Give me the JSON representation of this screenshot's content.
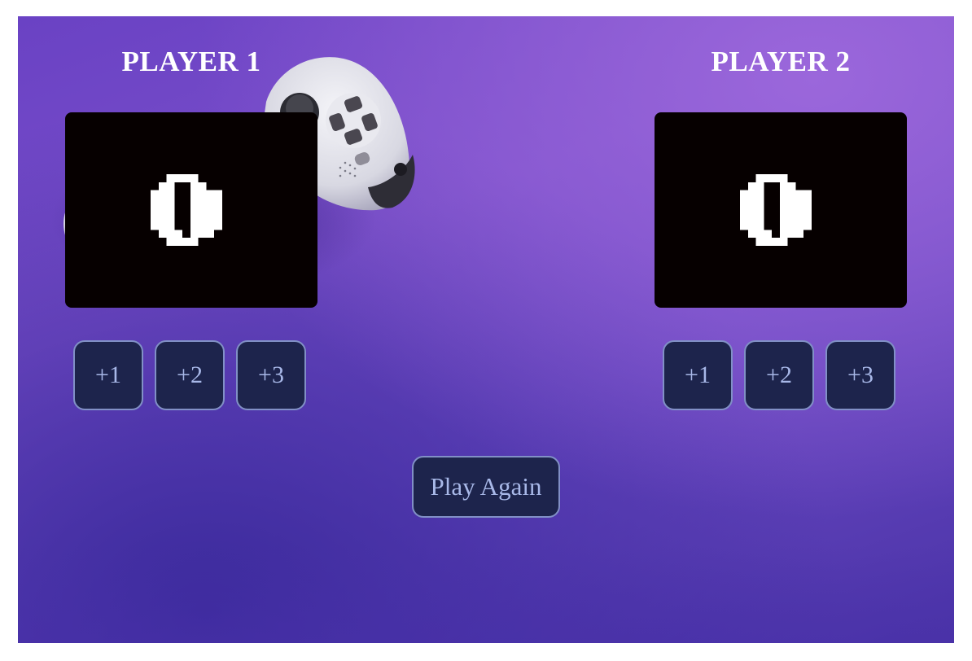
{
  "players": [
    {
      "title": "PLAYER 1",
      "score": "0",
      "buttons": [
        "+1",
        "+2",
        "+3"
      ]
    },
    {
      "title": "PLAYER 2",
      "score": "0",
      "buttons": [
        "+1",
        "+2",
        "+3"
      ]
    }
  ],
  "controls": {
    "play_again_label": "Play Again"
  },
  "decor": {
    "background_icon": "gamepad-icon"
  },
  "colors": {
    "background": "#6a42c4",
    "score_box": "#060000",
    "digit": "#ffffff",
    "button_bg": "#1d244c",
    "button_border": "#8190c6",
    "button_text": "#a8b8e8"
  }
}
